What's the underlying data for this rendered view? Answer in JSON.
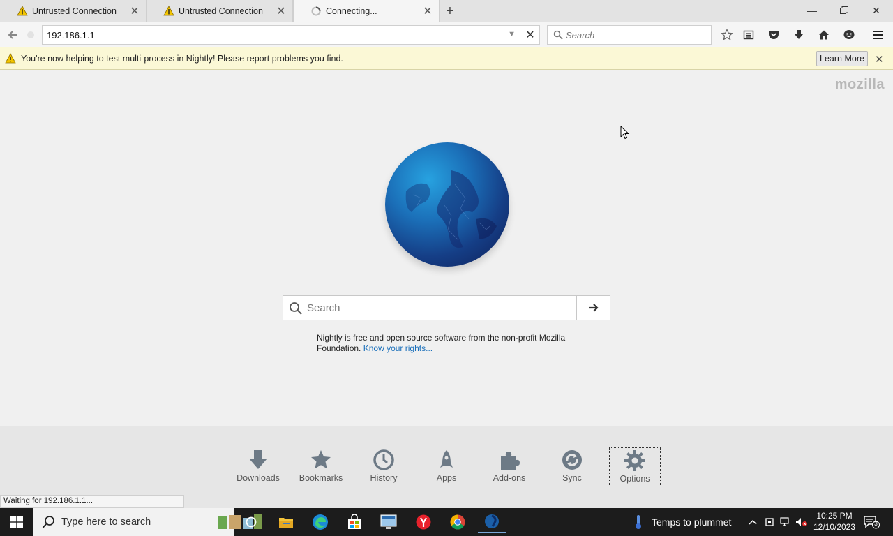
{
  "tabs": [
    {
      "title": "Untrusted Connection",
      "icon": "warning-icon",
      "active": false
    },
    {
      "title": "Untrusted Connection",
      "icon": "warning-icon",
      "active": false
    },
    {
      "title": "Connecting...",
      "icon": "loading-icon",
      "active": true
    }
  ],
  "navbar": {
    "url": "192.186.1.1",
    "search_placeholder": "Search"
  },
  "notification": {
    "message": "You're now helping to test multi-process in Nightly! Please report problems you find.",
    "learn_more": "Learn More"
  },
  "content": {
    "brand": "mozilla",
    "search_placeholder": "Search",
    "about_text": "Nightly is free and open source software from the non-profit Mozilla Foundation.",
    "about_link": "Know your rights..."
  },
  "launcher": [
    {
      "label": "Downloads",
      "icon": "download-icon"
    },
    {
      "label": "Bookmarks",
      "icon": "star-icon"
    },
    {
      "label": "History",
      "icon": "clock-icon"
    },
    {
      "label": "Apps",
      "icon": "rocket-icon"
    },
    {
      "label": "Add-ons",
      "icon": "puzzle-icon"
    },
    {
      "label": "Sync",
      "icon": "sync-icon"
    },
    {
      "label": "Options",
      "icon": "gear-icon",
      "selected": true
    }
  ],
  "status": "Waiting for 192.186.1.1...",
  "taskbar": {
    "search_placeholder": "Type here to search",
    "weather": "Temps to plummet",
    "time": "10:25 PM",
    "date": "12/10/2023",
    "notification_count": "3"
  },
  "colors": {
    "accent": "#1a6fba",
    "notif_bg": "#fbf8d6",
    "taskbar_bg": "#1c1c1c"
  }
}
